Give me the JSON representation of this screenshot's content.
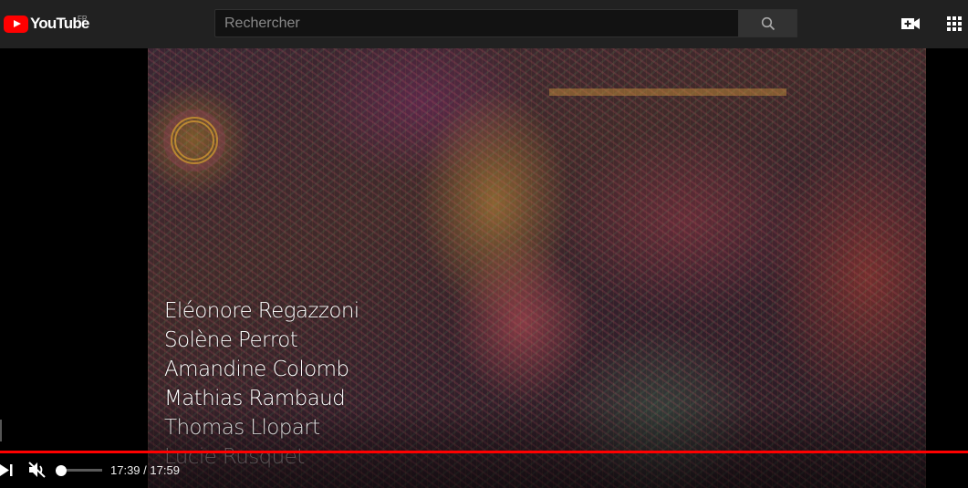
{
  "header": {
    "logo_text": "YouTube",
    "region": "FR",
    "search_placeholder": "Rechercher",
    "search_value": "",
    "icons": {
      "logo": "youtube-play-icon",
      "search": "search-icon",
      "create": "video-camera-plus-icon",
      "apps": "apps-grid-icon"
    }
  },
  "player": {
    "credits": [
      "Eléonore Regazzoni",
      "Solène Perrot",
      "Amandine Colomb",
      "Mathias Rambaud",
      "Thomas Llopart",
      "Lucie Rusquet"
    ],
    "time_current": "17:39",
    "time_separator": " / ",
    "time_total": "17:59",
    "progress_fraction": 0.98,
    "volume_fraction": 0.0,
    "muted": true,
    "icons": {
      "next": "skip-next-icon",
      "mute": "volume-muted-icon"
    },
    "colors": {
      "progress": "#ff0000",
      "header_bg": "#212121",
      "brand_red": "#ff0000"
    }
  }
}
